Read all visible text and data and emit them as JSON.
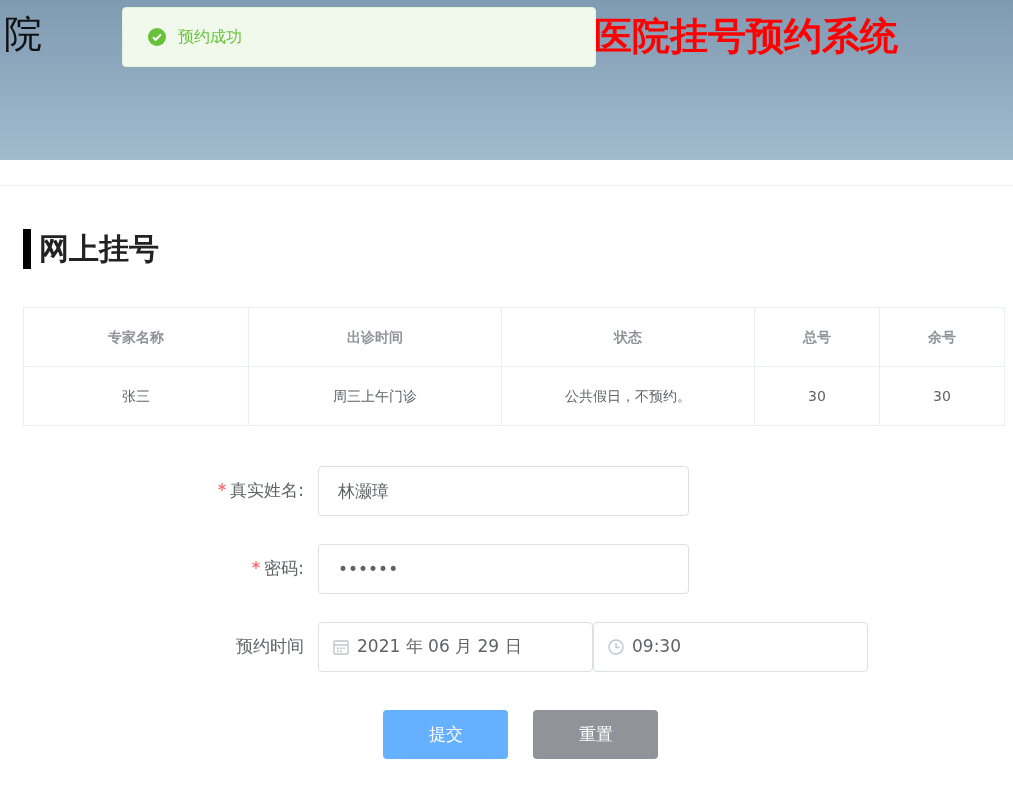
{
  "header": {
    "left_title": "院",
    "system_title": "医院挂号预约系统"
  },
  "toast": {
    "kind": "success",
    "message": "预约成功"
  },
  "section_title": "网上挂号",
  "table": {
    "columns": [
      "专家名称",
      "出诊时间",
      "状态",
      "总号",
      "余号"
    ],
    "rows": [
      [
        "张三",
        "周三上午门诊",
        "公共假日，不预约。",
        "30",
        "30"
      ]
    ]
  },
  "form": {
    "fields": [
      {
        "kind": "text",
        "label": "真实姓名:",
        "required": true,
        "value": "林灏璋"
      },
      {
        "kind": "text",
        "label": "密码:",
        "required": true,
        "value": "••••••"
      },
      {
        "kind": "datetime",
        "label": "预约时间",
        "required": false,
        "date": "2021 年 06 月 29 日",
        "time": "09:30"
      }
    ]
  },
  "buttons": [
    {
      "kind": "primary",
      "label": "提交"
    },
    {
      "kind": "secondary",
      "label": "重置"
    }
  ]
}
